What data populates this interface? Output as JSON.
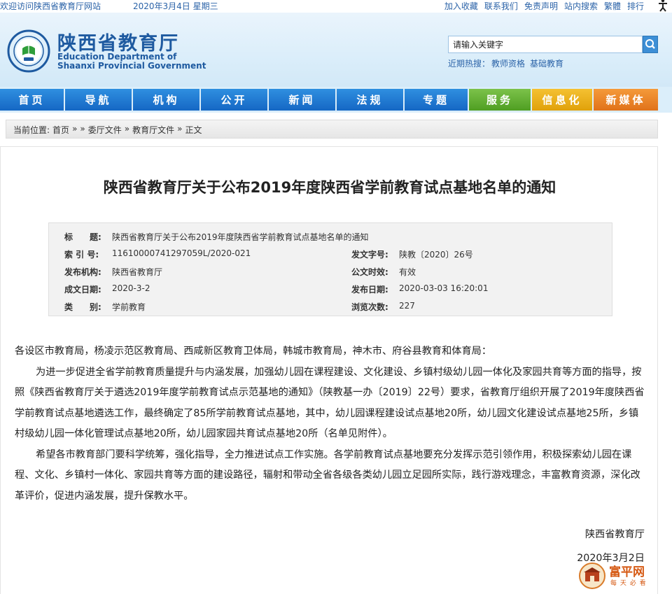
{
  "topbar": {
    "welcome": "欢迎访问陕西省教育厅网站",
    "date": "2020年3月4日  星期三",
    "links": [
      "加入收藏",
      "联系我们",
      "免责声明",
      "站内搜索",
      "繁體",
      "排行"
    ]
  },
  "header": {
    "site_name_cn": "陕西省教育厅",
    "site_name_en_line1": "Education Department of",
    "site_name_en_line2": "Shaanxi Provincial Government",
    "search_placeholder": "请输入关键字",
    "hot_label": "近期热搜：",
    "hot_words": [
      "教师资格",
      "基础教育"
    ]
  },
  "nav": {
    "items": [
      "首页",
      "导航",
      "机构",
      "公开",
      "新闻",
      "法规",
      "专题",
      "服务",
      "信息化",
      "新媒体"
    ]
  },
  "breadcrumb": {
    "label": "当前位置:",
    "items": [
      "首页",
      "»",
      "»",
      "委厅文件",
      "»",
      "教育厅文件",
      "»",
      "正文"
    ]
  },
  "article": {
    "title": "陕西省教育厅关于公布2019年度陕西省学前教育试点基地名单的通知",
    "meta": {
      "title_label": "标　　题:",
      "title_value": "陕西省教育厅关于公布2019年度陕西省学前教育试点基地名单的通知",
      "index_label": "索 引 号:",
      "index_value": "11610000741297059L/2020-021",
      "docno_label": "发文字号:",
      "docno_value": "陕教〔2020〕26号",
      "org_label": "发布机构:",
      "org_value": "陕西省教育厅",
      "validity_label": "公文时效:",
      "validity_value": "有效",
      "date_label": "成文日期:",
      "date_value": "2020-3-2",
      "pubdate_label": "发布日期:",
      "pubdate_value": "2020-03-03 16:20:01",
      "category_label": "类　　别:",
      "category_value": "学前教育",
      "views_label": "浏览次数:",
      "views_value": "227"
    },
    "salutation": "各设区市教育局，杨凌示范区教育局、西咸新区教育卫体局，韩城市教育局，神木市、府谷县教育和体育局：",
    "para1": "为进一步促进全省学前教育质量提升与内涵发展，加强幼儿园在课程建设、文化建设、乡镇村级幼儿园一体化及家园共育等方面的指导，按照《陕西省教育厅关于遴选2019年度学前教育试点示范基地的通知》（陕教基一办〔2019〕22号）要求，省教育厅组织开展了2019年度陕西省学前教育试点基地遴选工作，最终确定了85所学前教育试点基地，其中，幼儿园课程建设试点基地20所，幼儿园文化建设试点基地25所，乡镇村级幼儿园一体化管理试点基地20所，幼儿园家园共育试点基地20所（名单见附件）。",
    "para2": "希望各市教育部门要科学统筹，强化指导，全力推进试点工作实施。各学前教育试点基地要充分发挥示范引领作用，积极探索幼儿园在课程、文化、乡镇村一体化、家园共育等方面的建设路径，辐射和带动全省各级各类幼儿园立足园所实际，践行游戏理念，丰富教育资源，深化改革评价，促进内涵发展，提升保教水平。",
    "signature": "陕西省教育厅",
    "sign_date": "2020年3月2日"
  },
  "watermark": {
    "text": "富平网",
    "subtext": "每 天 必 看"
  }
}
